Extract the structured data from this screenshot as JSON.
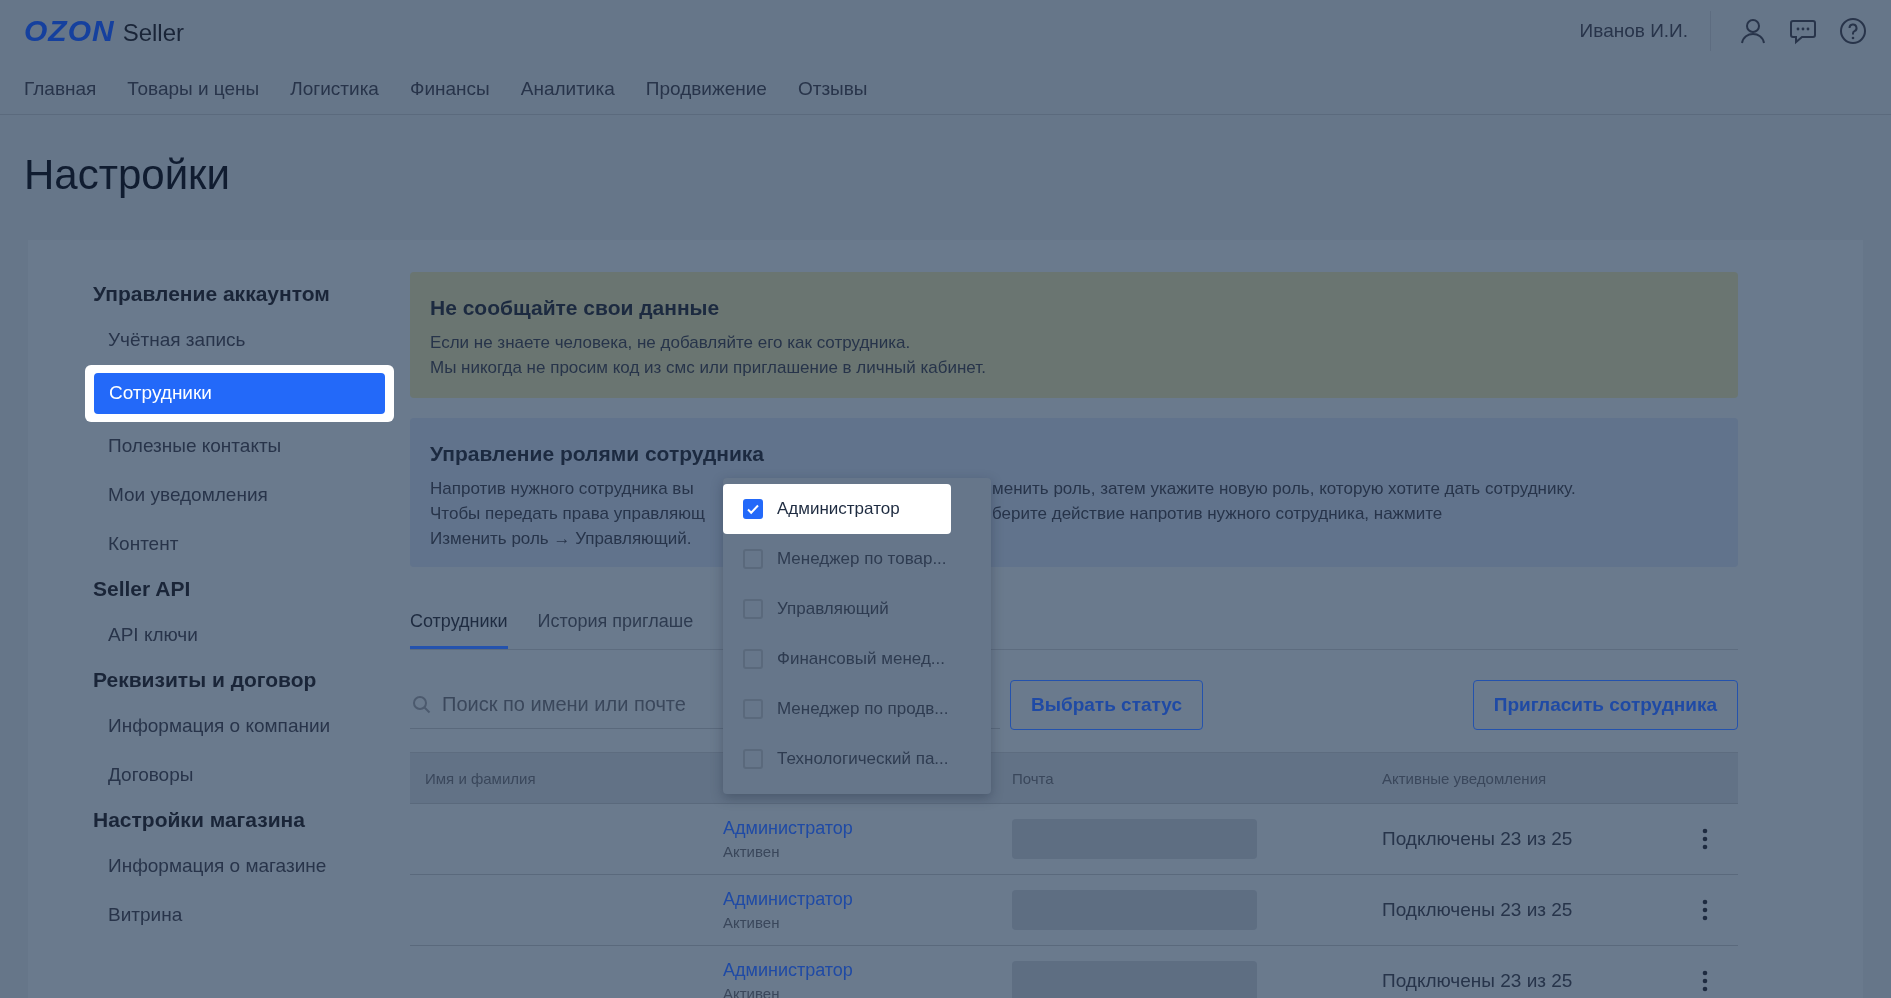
{
  "header": {
    "logo": "OZON",
    "logo_suffix": "Seller",
    "user_name": "Иванов И.И."
  },
  "nav": [
    "Главная",
    "Товары и цены",
    "Логистика",
    "Финансы",
    "Аналитика",
    "Продвижение",
    "Отзывы"
  ],
  "page_title": "Настройки",
  "sidebar": [
    {
      "heading": "Управление аккаунтом",
      "items": [
        {
          "label": "Учётная запись",
          "selected": false
        },
        {
          "label": "Сотрудники",
          "selected": true
        },
        {
          "label": "Полезные контакты",
          "selected": false
        },
        {
          "label": "Мои уведомления",
          "selected": false
        },
        {
          "label": "Контент",
          "selected": false
        }
      ]
    },
    {
      "heading": "Seller API",
      "items": [
        {
          "label": "API ключи",
          "selected": false
        }
      ]
    },
    {
      "heading": "Реквизиты и договор",
      "items": [
        {
          "label": "Информация о компании",
          "selected": false
        },
        {
          "label": "Договоры",
          "selected": false
        }
      ]
    },
    {
      "heading": "Настройки магазина",
      "items": [
        {
          "label": "Информация о магазине",
          "selected": false
        },
        {
          "label": "Витрина",
          "selected": false
        }
      ]
    }
  ],
  "warning": {
    "title": "Не сообщайте свои данные",
    "lines": [
      "Если не знаете человека, не добавляйте его как сотрудника.",
      "Мы никогда не просим код из смс или приглашение в личный кабинет."
    ]
  },
  "info": {
    "title": "Управление ролями сотрудника",
    "lines": [
      [
        "Напротив нужного сотрудника вы",
        "менить роль, затем укажите новую роль, которую хотите дать сотруднику."
      ],
      [
        "Чтобы передать права управляющ",
        "берите действие напротив нужного сотрудника, нажмите"
      ],
      [
        "Изменить роль → Управляющий."
      ]
    ]
  },
  "tabs": [
    {
      "label": "Сотрудники",
      "selected": true
    },
    {
      "label": "История приглаше",
      "selected": false
    }
  ],
  "search": {
    "placeholder": "Поиск по имени или почте"
  },
  "buttons": {
    "status": "Выбрать статус",
    "invite": "Пригласить сотрудника"
  },
  "table": {
    "columns": [
      "Имя и фамилия",
      "Почта",
      "Активные уведомления"
    ],
    "rows": [
      {
        "role": "Администратор",
        "status": "Активен",
        "notifications": "Подключены 23 из 25"
      },
      {
        "role": "Администратор",
        "status": "Активен",
        "notifications": "Подключены 23 из 25"
      },
      {
        "role": "Администратор",
        "status": "Активен",
        "notifications": "Подключены 23 из 25"
      }
    ]
  },
  "role_menu": [
    {
      "label": "Администратор",
      "checked": true,
      "highlighted": true
    },
    {
      "label": "Менеджер по товар...",
      "checked": false,
      "highlighted": false
    },
    {
      "label": "Управляющий",
      "checked": false,
      "highlighted": false
    },
    {
      "label": "Финансовый менед...",
      "checked": false,
      "highlighted": false
    },
    {
      "label": "Менеджер по продв...",
      "checked": false,
      "highlighted": false
    },
    {
      "label": "Технологический па...",
      "checked": false,
      "highlighted": false
    }
  ]
}
